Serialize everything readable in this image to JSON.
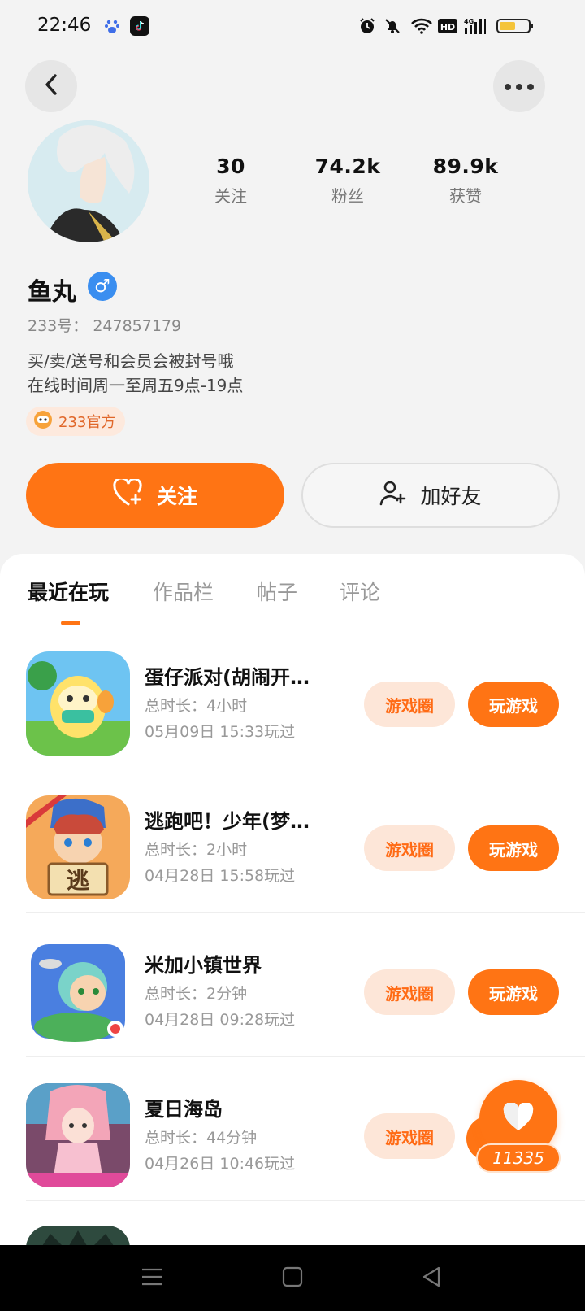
{
  "status_bar": {
    "time": "22:46",
    "battery_level": 0.55,
    "icons": [
      "baidu-icon",
      "tiktok-icon",
      "alarm-icon",
      "mute-icon",
      "wifi-icon",
      "hd-icon",
      "signal-4g-icon",
      "battery-icon"
    ]
  },
  "header": {
    "back_icon": "back-icon",
    "more_icon": "more-icon"
  },
  "profile": {
    "stats": [
      {
        "value": "30",
        "label": "关注"
      },
      {
        "value": "74.2k",
        "label": "粉丝"
      },
      {
        "value": "89.9k",
        "label": "获赞"
      }
    ],
    "username": "鱼丸",
    "gender": "♂",
    "uid_label": "233号：",
    "uid_value": "247857179",
    "bio": [
      "买/卖/送号和会员会被封号哦",
      "在线时间周一至周五9点-19点"
    ],
    "official_badge": "233官方",
    "follow_button": "关注",
    "add_friend_button": "加好友"
  },
  "tabs": [
    {
      "label": "最近在玩",
      "active": true
    },
    {
      "label": "作品栏",
      "active": false
    },
    {
      "label": "帖子",
      "active": false
    },
    {
      "label": "评论",
      "active": false
    }
  ],
  "games": [
    {
      "title": "蛋仔派对(胡闹开…",
      "duration": "总时长：4小时",
      "last_played": "05月09日 15:33玩过",
      "circle_label": "游戏圈",
      "play_label": "玩游戏",
      "show_play": true
    },
    {
      "title": "逃跑吧！少年(梦…",
      "duration": "总时长：2小时",
      "last_played": "04月28日 15:58玩过",
      "circle_label": "游戏圈",
      "play_label": "玩游戏",
      "show_play": true
    },
    {
      "title": "米加小镇世界",
      "duration": "总时长：2分钟",
      "last_played": "04月28日 09:28玩过",
      "circle_label": "游戏圈",
      "play_label": "玩游戏",
      "show_play": true
    },
    {
      "title": "夏日海岛",
      "duration": "总时长：44分钟",
      "last_played": "04月26日 10:46玩过",
      "circle_label": "游戏圈",
      "play_label": "玩游戏",
      "show_play": false
    }
  ],
  "floating_like": {
    "count": "11335"
  },
  "colors": {
    "accent": "#ff7414",
    "accent_light": "#fde6d8",
    "background": "#f3f3f3"
  }
}
